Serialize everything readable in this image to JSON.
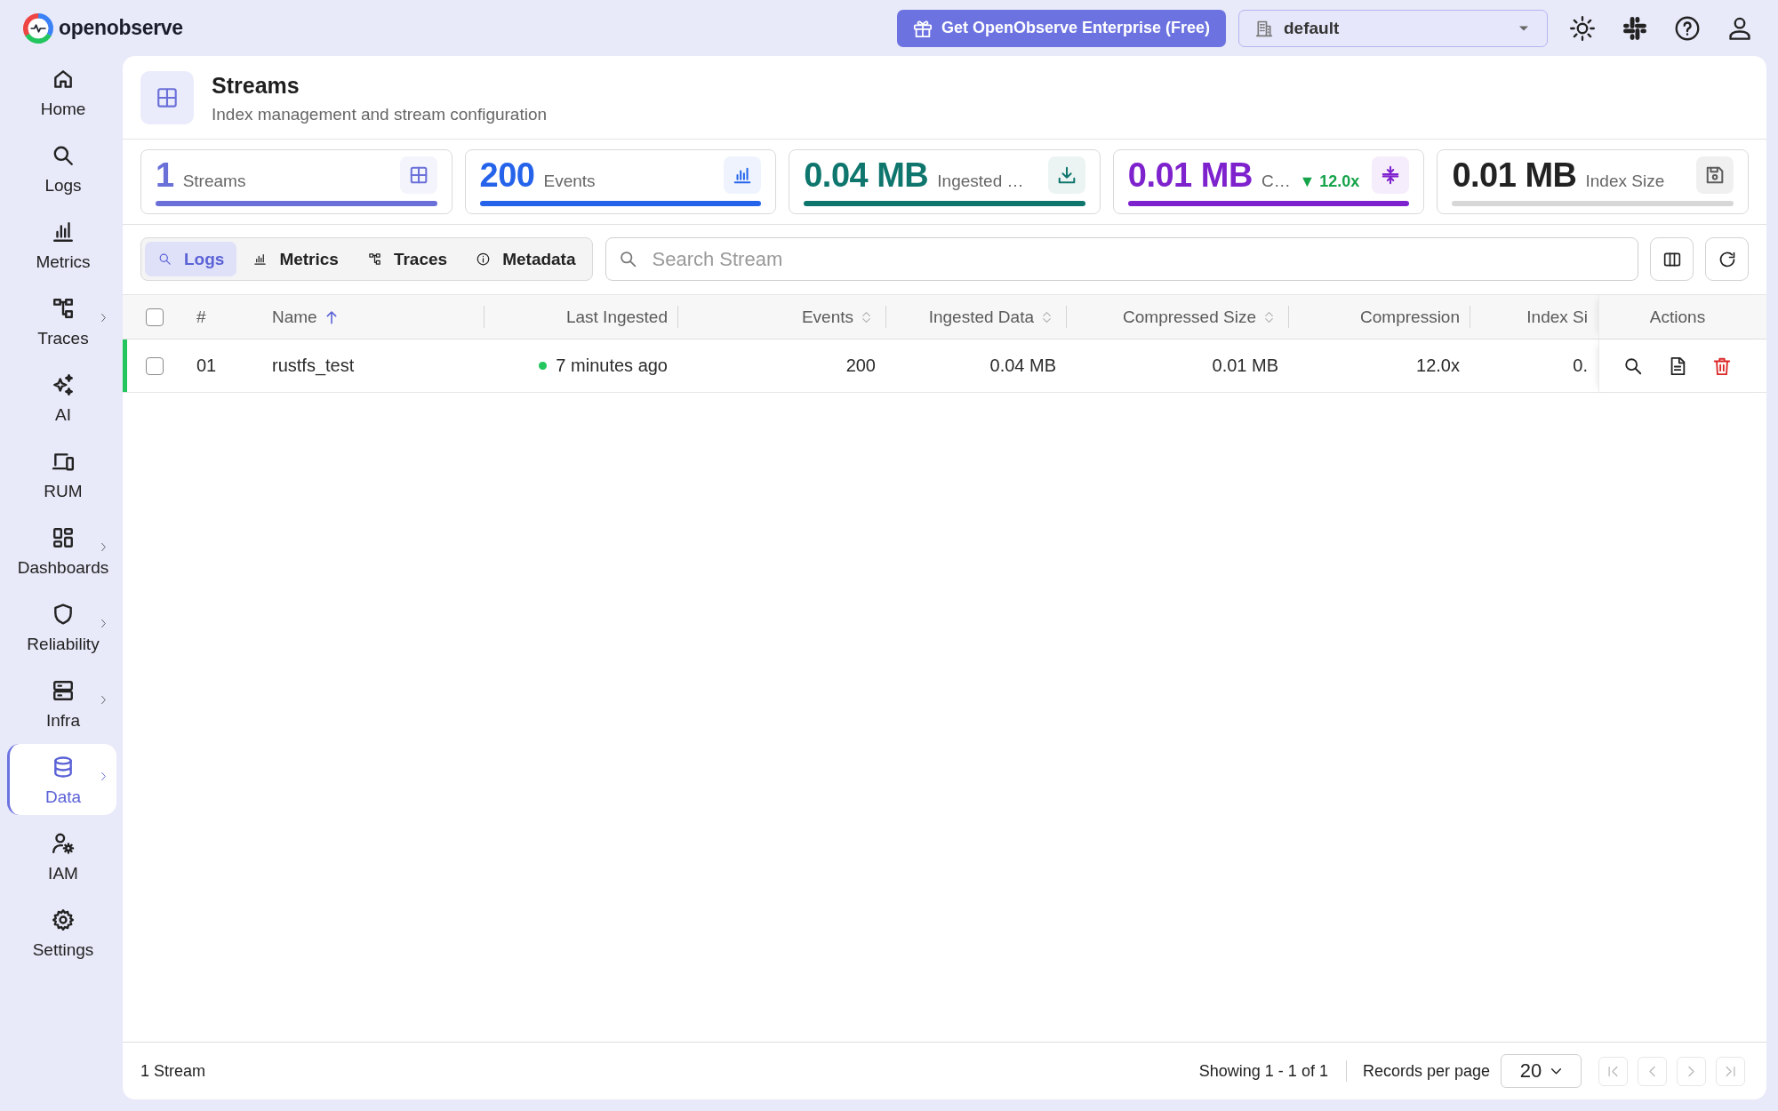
{
  "topbar": {
    "brand": "openobserve",
    "enterprise_button": "Get OpenObserve Enterprise (Free)",
    "org": "default"
  },
  "sidebar": {
    "items": [
      {
        "label": "Home",
        "selected": false,
        "expandable": false
      },
      {
        "label": "Logs",
        "selected": false,
        "expandable": false
      },
      {
        "label": "Metrics",
        "selected": false,
        "expandable": false
      },
      {
        "label": "Traces",
        "selected": false,
        "expandable": true
      },
      {
        "label": "AI",
        "selected": false,
        "expandable": false
      },
      {
        "label": "RUM",
        "selected": false,
        "expandable": false
      },
      {
        "label": "Dashboards",
        "selected": false,
        "expandable": true
      },
      {
        "label": "Reliability",
        "selected": false,
        "expandable": true
      },
      {
        "label": "Infra",
        "selected": false,
        "expandable": true
      },
      {
        "label": "Data",
        "selected": true,
        "expandable": true
      },
      {
        "label": "IAM",
        "selected": false,
        "expandable": false
      },
      {
        "label": "Settings",
        "selected": false,
        "expandable": false
      }
    ]
  },
  "page_header": {
    "title": "Streams",
    "subtitle": "Index management and stream configuration"
  },
  "stats": [
    {
      "value": "1",
      "label": "Streams",
      "color": "#6b70d9",
      "muted": false
    },
    {
      "value": "200",
      "label": "Events",
      "color": "#2563eb",
      "muted": false
    },
    {
      "value": "0.04 MB",
      "label": "Ingested …",
      "color": "#0f766e",
      "muted": false
    },
    {
      "value": "0.01 MB",
      "label": "C…",
      "trend": "▼ 12.0x",
      "color": "#7e22ce",
      "muted": false
    },
    {
      "value": "0.01 MB",
      "label": "Index Size",
      "color": "#222222",
      "muted": true
    }
  ],
  "type_tabs": [
    {
      "label": "Logs",
      "selected": true
    },
    {
      "label": "Metrics",
      "selected": false
    },
    {
      "label": "Traces",
      "selected": false
    },
    {
      "label": "Metadata",
      "selected": false
    }
  ],
  "search": {
    "placeholder": "Search Stream"
  },
  "table": {
    "select_all": {
      "checked": false
    },
    "columns": [
      {
        "label": "#",
        "sortable": false,
        "sorted": false
      },
      {
        "label": "Name",
        "sortable": true,
        "sorted": true
      },
      {
        "label": "Last Ingested",
        "sortable": false,
        "sorted": false
      },
      {
        "label": "Events",
        "sortable": true,
        "sorted": false
      },
      {
        "label": "Ingested Data",
        "sortable": true,
        "sorted": false
      },
      {
        "label": "Compressed Size",
        "sortable": true,
        "sorted": false
      },
      {
        "label": "Compression",
        "sortable": false,
        "sorted": false
      },
      {
        "label": "Index Si",
        "sortable": false,
        "sorted": false
      },
      {
        "label": "Actions",
        "sortable": false,
        "sorted": false
      }
    ],
    "rows": [
      {
        "checked": false,
        "color": "#22c55e",
        "cells": [
          "01",
          "rustfs_test",
          "7 minutes ago",
          "200",
          "0.04 MB",
          "0.01 MB",
          "12.0x",
          "0."
        ]
      }
    ]
  },
  "footer": {
    "count": "1 Stream",
    "summary": "Showing 1 - 1 of 1",
    "per_page_label": "Records per page",
    "per_page": "20",
    "pagination": [
      {
        "disabled": true
      },
      {
        "disabled": true
      },
      {
        "disabled": true
      },
      {
        "disabled": true
      }
    ]
  }
}
